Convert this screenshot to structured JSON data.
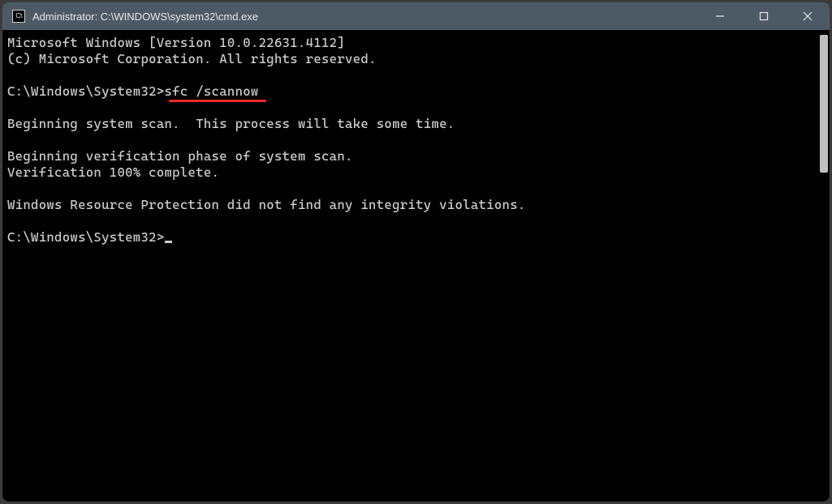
{
  "window": {
    "title": "Administrator: C:\\WINDOWS\\system32\\cmd.exe",
    "icon_label": "C:\\"
  },
  "terminal": {
    "banner1": "Microsoft Windows [Version 10.0.22631.4112]",
    "banner2": "(c) Microsoft Corporation. All rights reserved.",
    "prompt1_path": "C:\\Windows\\System32>",
    "prompt1_cmd": "sfc /scannow",
    "out1": "Beginning system scan.  This process will take some time.",
    "out2": "Beginning verification phase of system scan.",
    "out3": "Verification 100% complete.",
    "out4": "Windows Resource Protection did not find any integrity violations.",
    "prompt2_path": "C:\\Windows\\System32>"
  }
}
